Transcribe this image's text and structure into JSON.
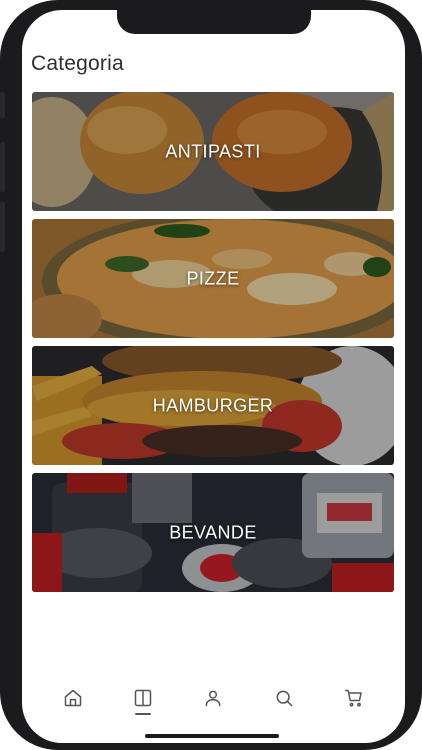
{
  "header": {
    "title": "Categoria"
  },
  "categories": [
    {
      "label": "ANTIPASTI",
      "image": "fried-appetizers-photo"
    },
    {
      "label": "PIZZE",
      "image": "pizza-photo"
    },
    {
      "label": "HAMBURGER",
      "image": "hamburger-photo"
    },
    {
      "label": "BEVANDE",
      "image": "soda-bottles-photo"
    }
  ],
  "tabbar": {
    "active": "menu",
    "items": [
      {
        "icon": "home-icon"
      },
      {
        "icon": "menu-book-icon"
      },
      {
        "icon": "user-icon"
      },
      {
        "icon": "search-icon"
      },
      {
        "icon": "cart-icon"
      }
    ]
  },
  "colors": {
    "icon": "#555555",
    "title": "#2f2f33",
    "label": "#ffffff"
  }
}
